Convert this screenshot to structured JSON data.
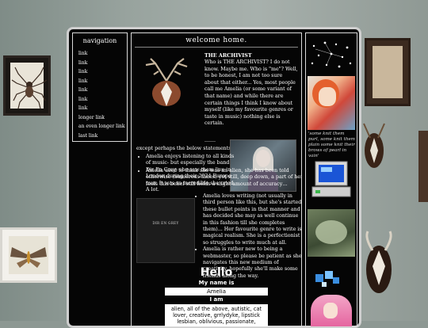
{
  "nav": {
    "title": "navigation",
    "items": [
      {
        "label": "link"
      },
      {
        "label": "link"
      },
      {
        "label": "link"
      },
      {
        "label": "link"
      },
      {
        "label": "link"
      },
      {
        "label": "link"
      },
      {
        "label": "link"
      },
      {
        "label": "longer link"
      },
      {
        "label": "an even longer link"
      },
      {
        "label": "last link"
      }
    ]
  },
  "main": {
    "title": "welcome home.",
    "bio_heading": "THE ARCHIVIST",
    "bio": "Who is THE ARCHIVIST? I do not know. Maybe me. Who is \"me\"? Well, to be honest, I am not too sure about that either... Yes, most people call me Amelia (or some variant of that name) and while there are certain things I think I know about myself (like my favourite genres or taste in music) nothing else is certain.",
    "ellipsis": ".......",
    "except": "except perhaps the below statements?",
    "bullets": [
      "Amelia enjoys listening to all kinds of music- but especially the band Dir En Grey- she saw them live in London during their 2024 Europe tour. It was so incredible she cried. A lot.",
      "Amelia used to think she was an alien, she has been told otherwise (numerous times) yet still, deep down, a part of her feels this belief still holds a slight amount of accuracy…",
      "Amelia loves writing (not usually in third person like this, but she's started these bullet points in that manner and has decided she may as well continue in this fashion till she completes them)... Her favourite genre to write is magical realism. She is a perfectionist so struggles to write much at all.",
      "Amelia is rather new to being a webmaster, so please be patient as she navigates this new medium of creativity, hopefully she'll make some friends along the way."
    ],
    "photo2_caption": "DIR EN GREY",
    "hello": {
      "title": "Hello",
      "name_label": "My name is",
      "name_value": "Amelia",
      "iam_label": "I am",
      "iam_value": "alien, all of the above, autistic, cat lover, creative, grrlydyke, lipstick lesbian, oblivious, passionate,"
    }
  },
  "side": {
    "quote": "'some knit them purl, some knit them plain some knit their brows of pearl in vain'"
  }
}
